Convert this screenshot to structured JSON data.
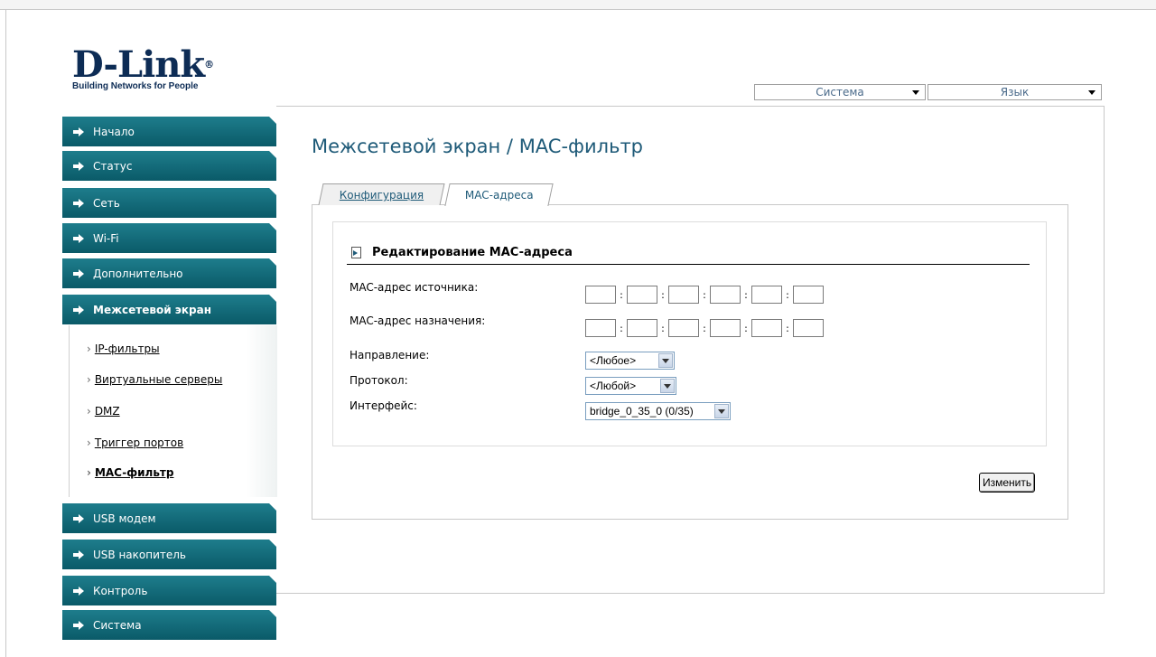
{
  "logo": {
    "brand": "D-Link",
    "tagline": "Building Networks for People"
  },
  "top_selects": {
    "system": "Система",
    "language": "Язык"
  },
  "sidebar": {
    "items": [
      {
        "label": "Начало"
      },
      {
        "label": "Статус"
      },
      {
        "label": "Сеть"
      },
      {
        "label": "Wi-Fi"
      },
      {
        "label": "Дополнительно"
      },
      {
        "label": "Межсетевой экран"
      },
      {
        "label": "USB модем"
      },
      {
        "label": "USB накопитель"
      },
      {
        "label": "Контроль"
      },
      {
        "label": "Система"
      }
    ],
    "subitems": [
      {
        "label": "IP-фильтры"
      },
      {
        "label": "Виртуальные серверы"
      },
      {
        "label": "DMZ"
      },
      {
        "label": "Триггер портов"
      },
      {
        "label": "MAC-фильтр"
      }
    ]
  },
  "page": {
    "title": "Межсетевой экран / MAC-фильтр",
    "tabs": [
      {
        "label": "Конфигурация"
      },
      {
        "label": "MAC-адреса"
      }
    ]
  },
  "form": {
    "section_title": "Редактирование MAC-адреса",
    "src_mac_label": "MAC-адрес источника:",
    "dst_mac_label": "MAC-адрес назначения:",
    "direction_label": "Направление:",
    "direction_value": "<Любое>",
    "protocol_label": "Протокол:",
    "protocol_value": "<Любой>",
    "interface_label": "Интерфейс:",
    "interface_value": "bridge_0_35_0 (0/35)",
    "change_button": "Изменить"
  }
}
